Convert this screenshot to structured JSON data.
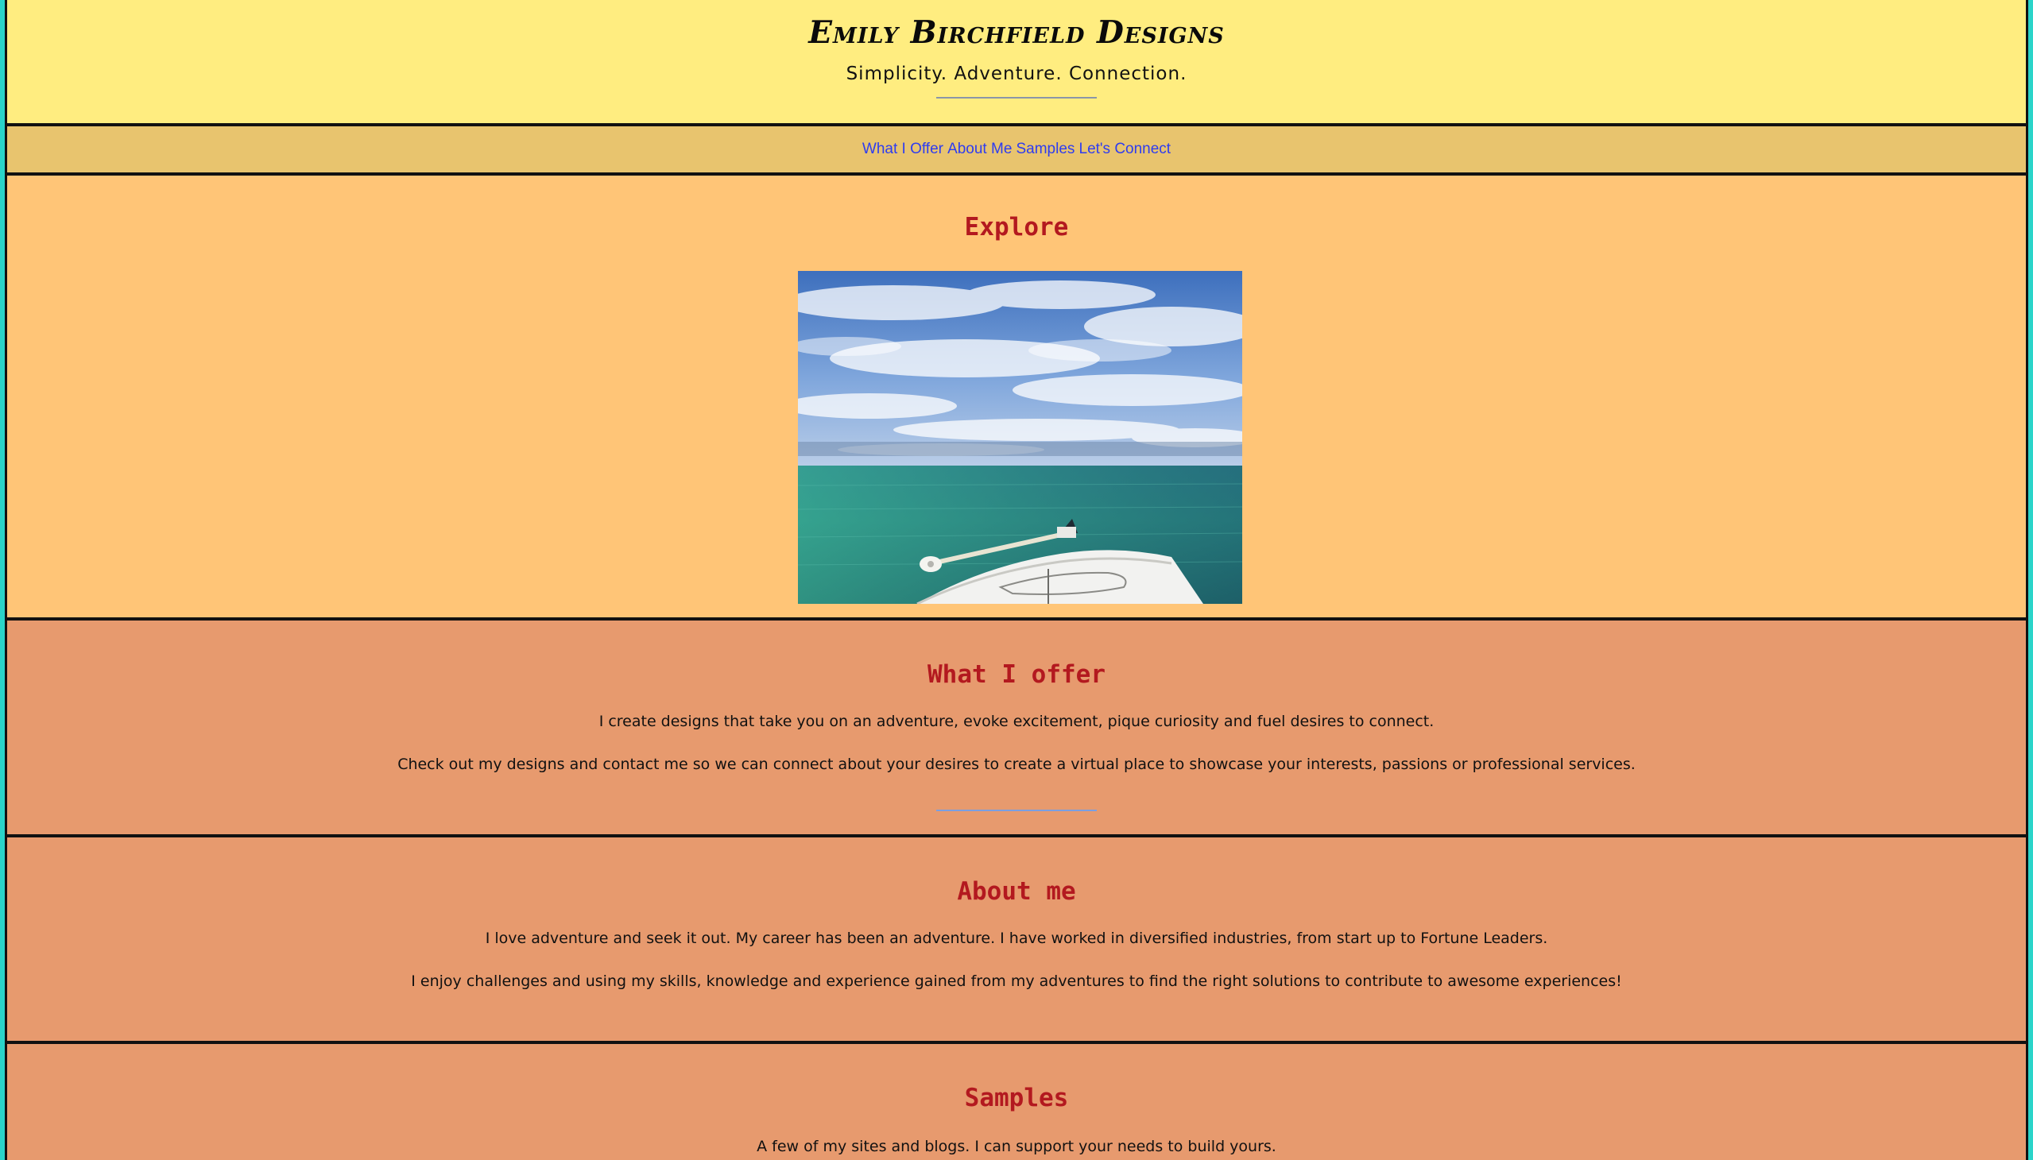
{
  "header": {
    "title": "Emily Birchfield Designs",
    "tagline": "Simplicity. Adventure. Connection."
  },
  "nav": {
    "items": [
      "What I Offer",
      "About Me",
      "Samples",
      "Let's Connect"
    ]
  },
  "explore": {
    "heading": "Explore",
    "image_alt": "boat bow on turquoise sea under cloudy blue sky"
  },
  "offer": {
    "heading": "What I offer",
    "p1": "I create designs that take you on an adventure, evoke excitement, pique curiosity and fuel desires to connect.",
    "p2": "Check out my designs and contact me so we can connect about your desires to create a virtual place to showcase your interests, passions or professional services."
  },
  "about": {
    "heading": "About me",
    "p1": "I love adventure and seek it out. My career has been an adventure. I have worked in diversified industries, from start up to Fortune Leaders.",
    "p2": "I enjoy challenges and using my skills, knowledge and experience gained from my adventures to find the right solutions to contribute to awesome experiences!"
  },
  "samples": {
    "heading": "Samples",
    "p1": "A few of my sites and blogs. I can support your needs to build yours."
  },
  "colors": {
    "header_bg": "#ffed80",
    "nav_bg": "#e8c46e",
    "explore_bg": "#ffc577",
    "section_bg": "#e79a6e",
    "heading": "#b3191f",
    "link": "#2e3cf0",
    "page_border": "#2ad4c9"
  }
}
